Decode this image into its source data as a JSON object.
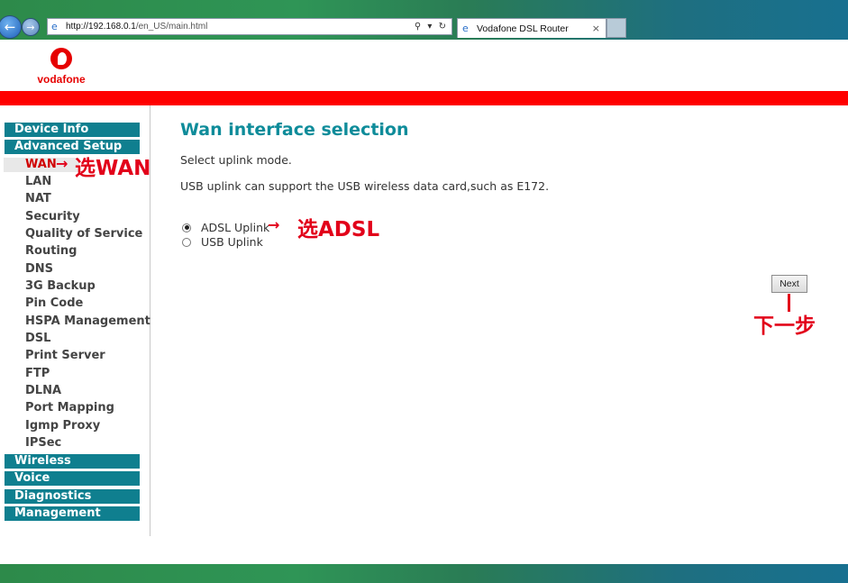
{
  "browser": {
    "url_host": "http://192.168.0.1",
    "url_path": "/en_US/main.html",
    "tab_title": "Vodafone DSL Router",
    "tab_close": "×",
    "back_glyph": "←",
    "forward_glyph": "→",
    "address_tools": "⚲ ▾ ↻"
  },
  "brand": {
    "logo_text": "vodafone",
    "color": "#e60000"
  },
  "sidebar": {
    "sections": [
      {
        "label": "Device Info"
      },
      {
        "label": "Advanced Setup"
      }
    ],
    "advanced_items": [
      {
        "label": "WAN",
        "active": true
      },
      {
        "label": "LAN"
      },
      {
        "label": "NAT"
      },
      {
        "label": "Security"
      },
      {
        "label": "Quality of Service"
      },
      {
        "label": "Routing"
      },
      {
        "label": "DNS"
      },
      {
        "label": "3G Backup"
      },
      {
        "label": "Pin Code"
      },
      {
        "label": "HSPA Management"
      },
      {
        "label": "DSL"
      },
      {
        "label": "Print Server"
      },
      {
        "label": "FTP"
      },
      {
        "label": "DLNA"
      },
      {
        "label": "Port Mapping"
      },
      {
        "label": "Igmp Proxy"
      },
      {
        "label": "IPSec"
      }
    ],
    "bottom_sections": [
      {
        "label": "Wireless"
      },
      {
        "label": "Voice"
      },
      {
        "label": "Diagnostics"
      },
      {
        "label": "Management"
      }
    ],
    "accent_color": "#0f7f8f"
  },
  "main": {
    "title": "Wan interface selection",
    "intro": "Select uplink mode.",
    "note": "USB uplink can support the USB wireless data card,such as E172.",
    "options": [
      {
        "label": "ADSL Uplink",
        "selected": true
      },
      {
        "label": "USB Uplink",
        "selected": false
      }
    ],
    "next_button": "Next"
  },
  "annotations": {
    "wan": "选WAN",
    "adsl": "选ADSL",
    "next": "下一步",
    "arrow": "→",
    "color": "#e2001a"
  }
}
